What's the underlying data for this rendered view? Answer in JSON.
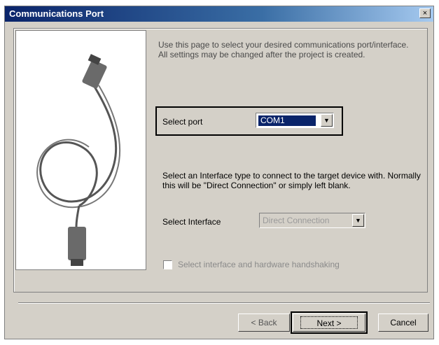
{
  "window": {
    "title": "Communications Port",
    "close_label": "×"
  },
  "intro_text": "Use this page to select your desired communications port/interface. All settings may be changed after the project is created.",
  "port": {
    "label": "Select port",
    "value": "COM1"
  },
  "interface": {
    "help_text": "Select an Interface type to connect to the target device with. Normally this will be \"Direct Connection\" or simply left blank.",
    "label": "Select Interface",
    "value": "Direct Connection"
  },
  "checkbox": {
    "label": "Select interface and hardware handshaking",
    "checked": false
  },
  "buttons": {
    "back": "< Back",
    "next": "Next >",
    "cancel": "Cancel"
  },
  "icons": {
    "dropdown": "chevron-down-icon",
    "illustration": "serial-cable-image"
  }
}
